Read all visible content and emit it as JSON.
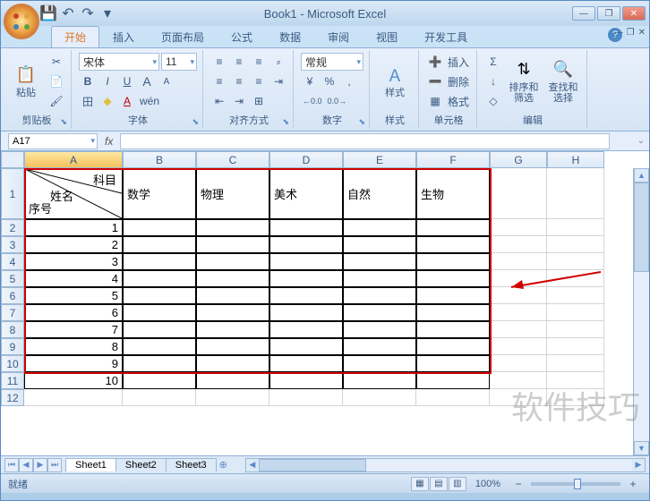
{
  "title": "Book1 - Microsoft Excel",
  "qat": {
    "save": "💾",
    "undo": "↶",
    "redo": "↷",
    "down": "▾"
  },
  "tabs": [
    "开始",
    "插入",
    "页面布局",
    "公式",
    "数据",
    "审阅",
    "视图",
    "开发工具"
  ],
  "activeTab": 0,
  "ribbon": {
    "clipboard": {
      "label": "剪贴板",
      "paste": "粘贴",
      "pasteIcon": "📋",
      "cut": "✂",
      "copy": "📄",
      "brush": "🖌"
    },
    "font": {
      "label": "字体",
      "name": "宋体",
      "size": "11",
      "bold": "B",
      "italic": "I",
      "underline": "U",
      "grow": "A",
      "shrink": "A",
      "border": "田",
      "fill": "◆",
      "color": "A",
      "phonetic": "wén"
    },
    "align": {
      "label": "对齐方式"
    },
    "number": {
      "label": "数字",
      "format": "常规",
      "currency": "¥",
      "percent": "%",
      "comma": ",",
      "inc": "←0.0",
      "dec": "0.0→"
    },
    "styles": {
      "label": "样式",
      "btn": "样式"
    },
    "cells": {
      "label": "单元格",
      "insert": "插入",
      "delete": "删除",
      "format": "格式"
    },
    "editing": {
      "label": "编辑",
      "sum": "Σ",
      "fill": "↓",
      "clear": "◇",
      "sort": "排序和\n筛选",
      "find": "查找和\n选择"
    }
  },
  "namebox": "A17",
  "columns": [
    "A",
    "B",
    "C",
    "D",
    "E",
    "F",
    "G",
    "H"
  ],
  "headerCell": {
    "line1": "科目",
    "line2": "姓名",
    "line3": "序号"
  },
  "subjects": [
    "数学",
    "物理",
    "美术",
    "自然",
    "生物"
  ],
  "dataRows": [
    1,
    2,
    3,
    4,
    5,
    6,
    7,
    8,
    9,
    10
  ],
  "rowNumbers": [
    1,
    2,
    3,
    4,
    5,
    6,
    7,
    8,
    9,
    10,
    11,
    12
  ],
  "sheets": [
    "Sheet1",
    "Sheet2",
    "Sheet3"
  ],
  "status": "就绪",
  "zoom": "100%",
  "watermark": "软件技巧"
}
